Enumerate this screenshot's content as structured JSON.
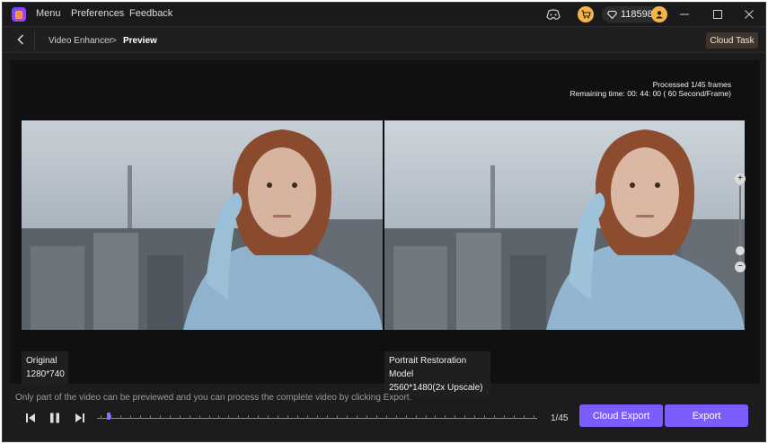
{
  "titlebar": {
    "menu": [
      "Menu",
      "Preferences",
      "Feedback"
    ],
    "credits": "118598"
  },
  "nav": {
    "breadcrumb_parent": "Video Enhancer",
    "breadcrumb_separator": ">",
    "breadcrumb_current": "Preview",
    "cloud_task_label": "Cloud Task"
  },
  "preview": {
    "processed_text": "Processed 1/45 frames",
    "remaining_text": "Remaining time: 00: 44: 00 ( 60 Second/Frame)",
    "original_label": "Original",
    "original_resolution": "1280*740",
    "model_label": "Portrait Restoration Model",
    "model_resolution": "2560*1480(2x Upscale)"
  },
  "footer": {
    "hint": "Only part of the video can be previewed and you can process the complete video by clicking Export.",
    "frame_counter": "1/45",
    "progress_fraction": 0.022,
    "cloud_export_label": "Cloud Export",
    "export_label": "Export"
  },
  "colors": {
    "accent": "#7b5cff",
    "cloud_task_bg": "#3d342c",
    "background": "#1c1c1e"
  }
}
